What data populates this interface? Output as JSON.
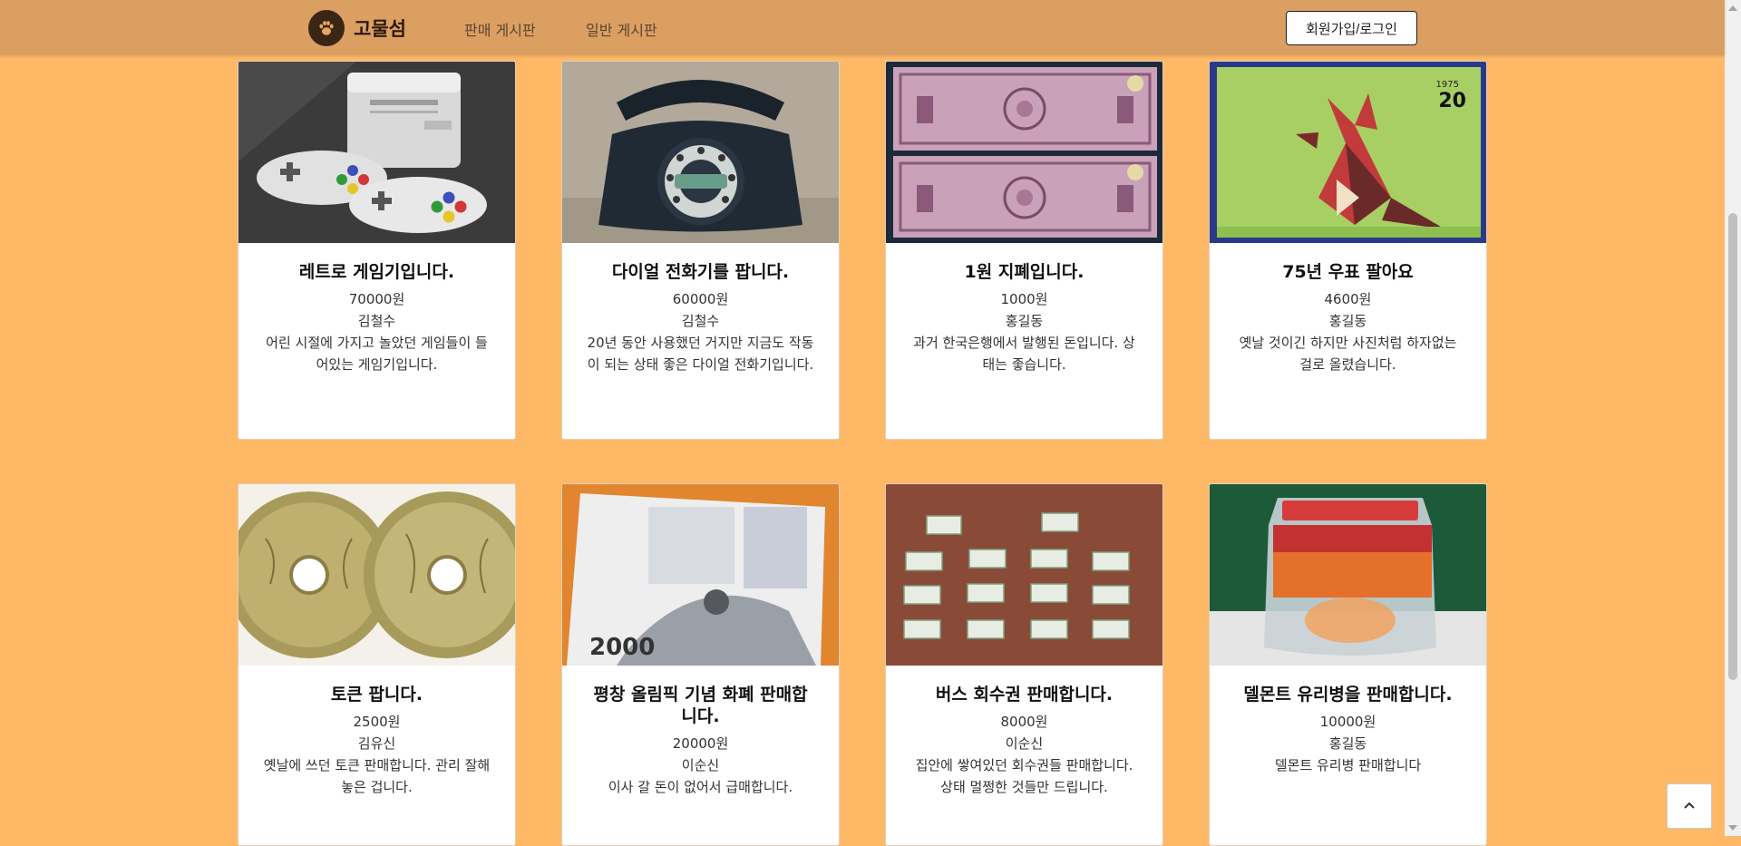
{
  "nav": {
    "brand": "고물섬",
    "links": [
      "판매 게시판",
      "일반 게시판"
    ],
    "login_label": "회원가입/로그인"
  },
  "products": [
    {
      "title": "레트로 게임기입니다.",
      "price": "70000원",
      "seller": "김철수",
      "description": "어린 시절에 가지고 놀았던 게임들이 들어있는 게임기입니다."
    },
    {
      "title": "다이얼 전화기를 팝니다.",
      "price": "60000원",
      "seller": "김철수",
      "description": "20년 동안 사용했던 거지만 지금도 작동이 되는 상태 좋은 다이얼 전화기입니다."
    },
    {
      "title": "1원 지폐입니다.",
      "price": "1000원",
      "seller": "홍길동",
      "description": "과거 한국은행에서 발행된 돈입니다. 상태는 좋습니다."
    },
    {
      "title": "75년 우표 팔아요",
      "price": "4600원",
      "seller": "홍길동",
      "description": "옛날 것이긴 하지만 사진처럼 하자없는 걸로 올렸습니다."
    },
    {
      "title": "토큰 팝니다.",
      "price": "2500원",
      "seller": "김유신",
      "description": "옛날에 쓰던 토큰 판매합니다. 관리 잘해 놓은 겁니다."
    },
    {
      "title": "평창 올림픽 기념 화폐 판매합니다.",
      "price": "20000원",
      "seller": "이순신",
      "description": "이사 갈 돈이 없어서 급매합니다."
    },
    {
      "title": "버스 회수권 판매합니다.",
      "price": "8000원",
      "seller": "이순신",
      "description": "집안에 쌓여있던 회수권들 판매합니다. 상태 멀쩡한 것들만 드립니다."
    },
    {
      "title": "델몬트 유리병을 판매합니다.",
      "price": "10000원",
      "seller": "홍길동",
      "description": "델몬트 유리병 판매합니다"
    }
  ],
  "image_labels": {
    "stamp_year": "1975",
    "stamp_value": "20",
    "banknote_value": "2000"
  },
  "colors": {
    "page_background": "#FFB866",
    "navbar": "#DC9F62",
    "card_background": "#FFFFFF"
  },
  "icons": {
    "brand": "paw-icon",
    "back_to_top": "chevron-up-icon"
  }
}
